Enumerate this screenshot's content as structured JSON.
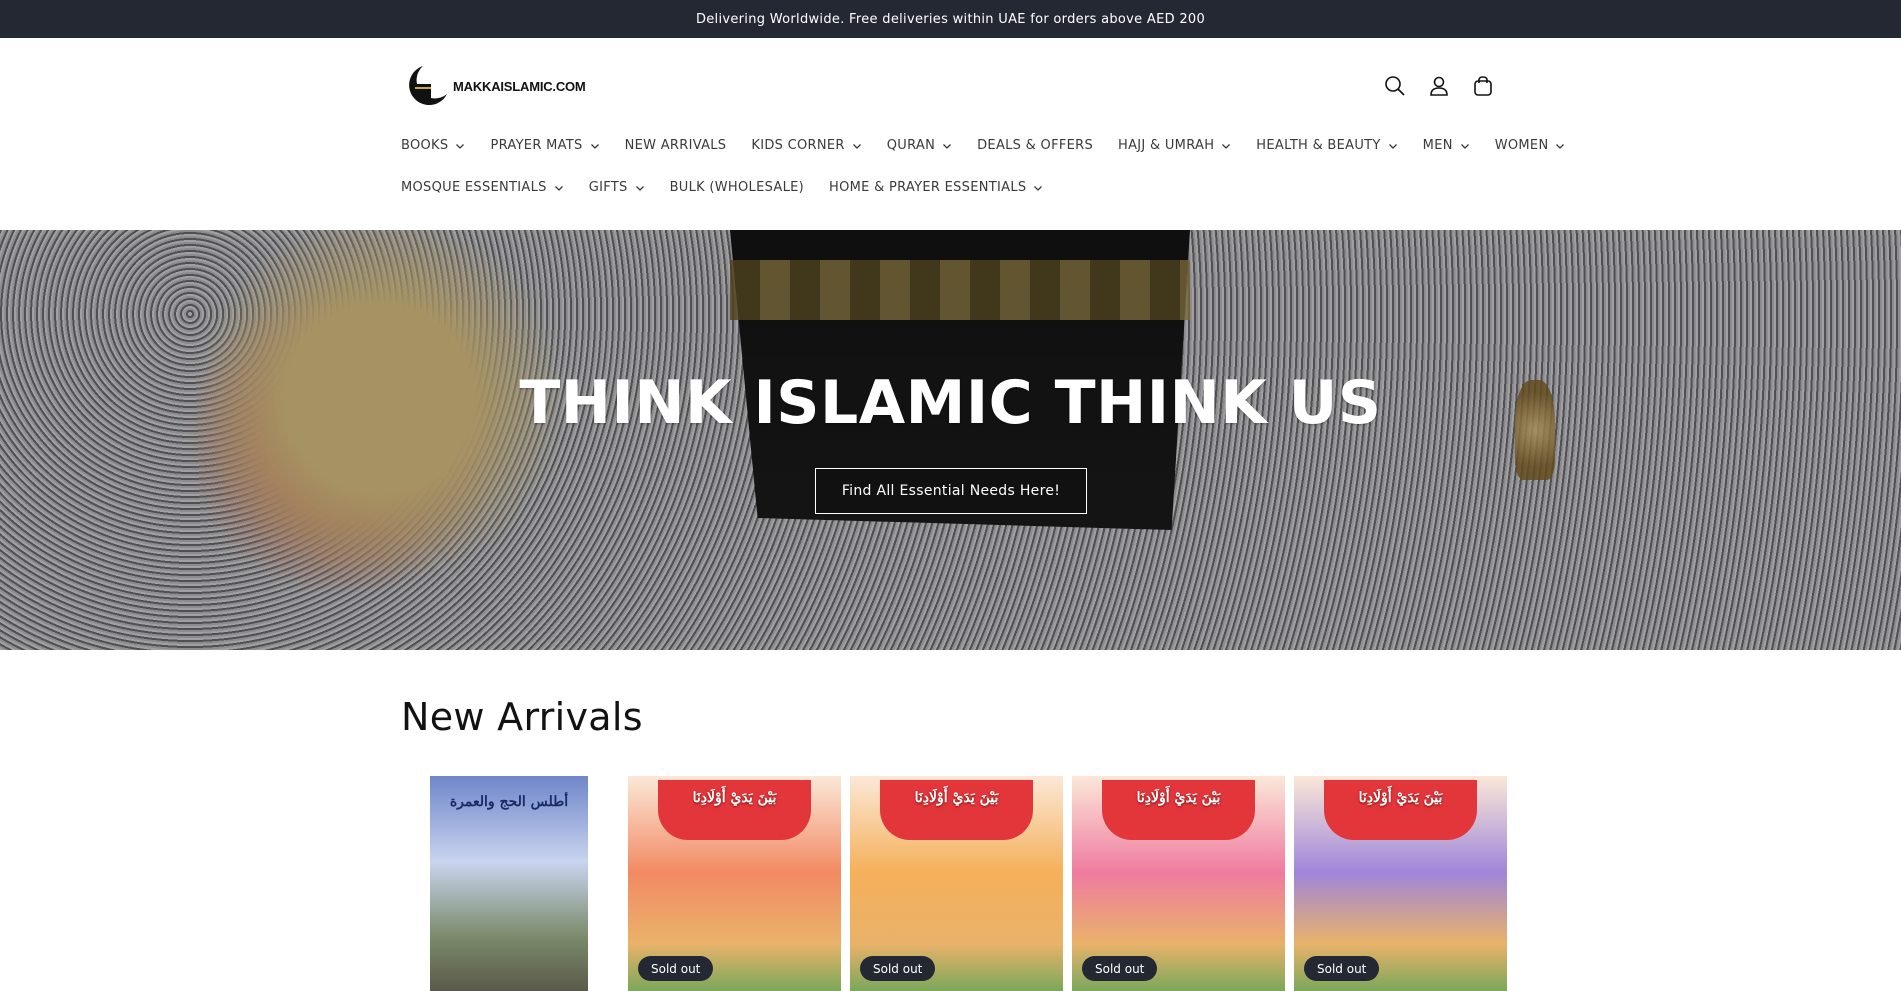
{
  "announcement": {
    "text": "Delivering Worldwide. Free deliveries within UAE for orders above AED 200"
  },
  "header": {
    "logo_text": "MAKKAISLAMIC.COM",
    "icons": [
      "search-icon",
      "account-icon",
      "cart-icon"
    ]
  },
  "nav": {
    "row1": [
      {
        "label": "BOOKS",
        "dropdown": true
      },
      {
        "label": "PRAYER MATS",
        "dropdown": true
      },
      {
        "label": "NEW ARRIVALS",
        "dropdown": false
      },
      {
        "label": "KIDS CORNER",
        "dropdown": true
      },
      {
        "label": "QURAN",
        "dropdown": true
      },
      {
        "label": "DEALS & OFFERS",
        "dropdown": false
      },
      {
        "label": "HAJJ & UMRAH",
        "dropdown": true
      },
      {
        "label": "HEALTH & BEAUTY",
        "dropdown": true
      },
      {
        "label": "MEN",
        "dropdown": true
      },
      {
        "label": "WOMEN",
        "dropdown": true
      }
    ],
    "row2": [
      {
        "label": "MOSQUE ESSENTIALS",
        "dropdown": true
      },
      {
        "label": "GIFTS",
        "dropdown": true
      },
      {
        "label": "BULK (WHOLESALE)",
        "dropdown": false
      },
      {
        "label": "HOME & PRAYER ESSENTIALS",
        "dropdown": true
      }
    ]
  },
  "hero": {
    "title": "THINK ISLAMIC THINK US",
    "button": "Find All Essential Needs Here!"
  },
  "new_arrivals": {
    "heading": "New Arrivals",
    "products": [
      {
        "badge": "",
        "cover_text": "أطلس الحج والعمرة",
        "color": "#6f86c9"
      },
      {
        "badge": "Sold out",
        "cover_text": "بَيْنَ يَدَيْ أَوْلَادِنَا",
        "color": "#f28a63"
      },
      {
        "badge": "Sold out",
        "cover_text": "بَيْنَ يَدَيْ أَوْلَادِنَا",
        "color": "#f5b05a"
      },
      {
        "badge": "Sold out",
        "cover_text": "بَيْنَ يَدَيْ أَوْلَادِنَا",
        "color": "#ef7ba0"
      },
      {
        "badge": "Sold out",
        "cover_text": "بَيْنَ يَدَيْ أَوْلَادِنَا",
        "color": "#9f86d9"
      }
    ]
  }
}
